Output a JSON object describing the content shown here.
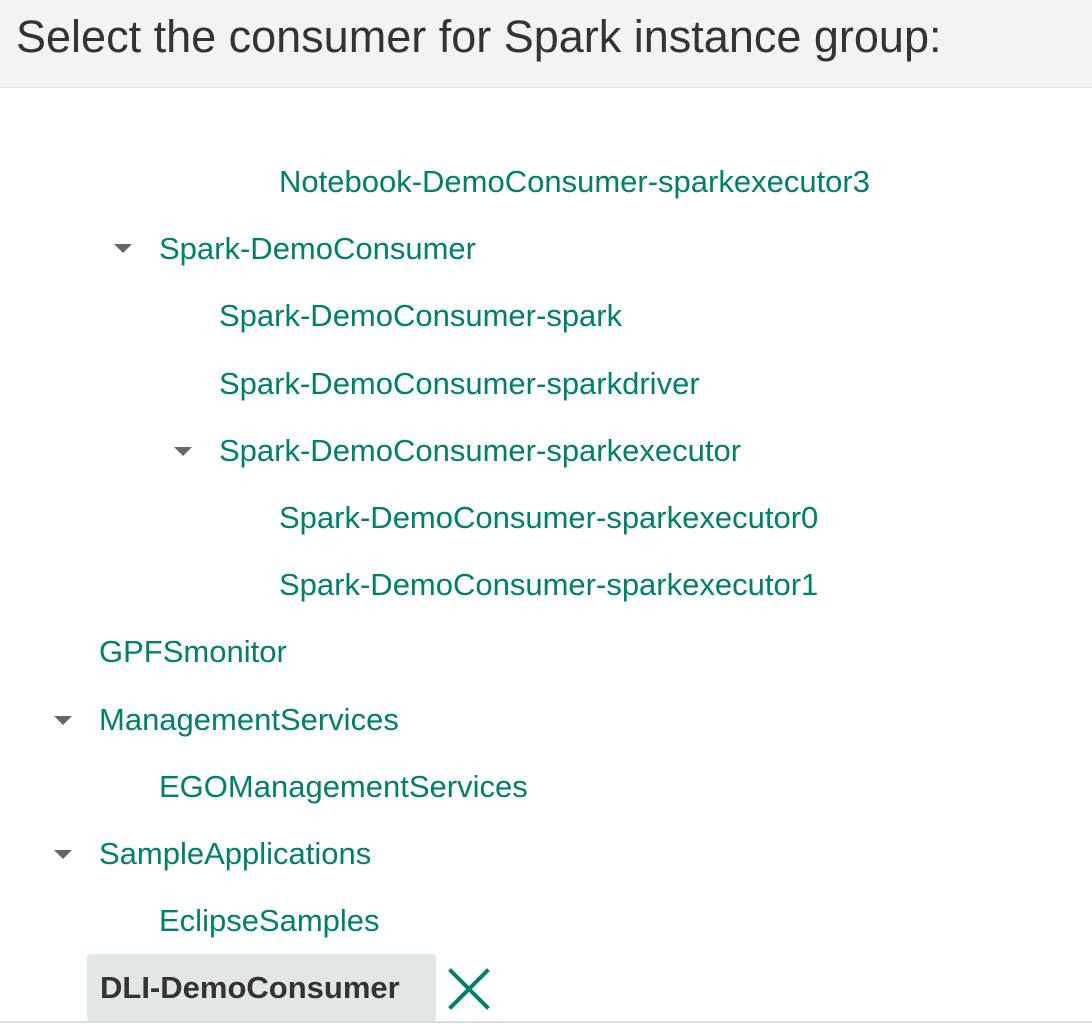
{
  "header": {
    "title": "Select the consumer for Spark instance group:"
  },
  "tree": {
    "nodes": [
      {
        "label": "Notebook-DemoConsumer-sparkexecutor3",
        "expanded": null
      },
      {
        "label": "Spark-DemoConsumer",
        "expanded": true
      },
      {
        "label": "Spark-DemoConsumer-spark",
        "expanded": null
      },
      {
        "label": "Spark-DemoConsumer-sparkdriver",
        "expanded": null
      },
      {
        "label": "Spark-DemoConsumer-sparkexecutor",
        "expanded": true
      },
      {
        "label": "Spark-DemoConsumer-sparkexecutor0",
        "expanded": null
      },
      {
        "label": "Spark-DemoConsumer-sparkexecutor1",
        "expanded": null
      },
      {
        "label": "GPFSmonitor",
        "expanded": null
      },
      {
        "label": "ManagementServices",
        "expanded": true
      },
      {
        "label": "EGOManagementServices",
        "expanded": null
      },
      {
        "label": "SampleApplications",
        "expanded": true
      },
      {
        "label": "EclipseSamples",
        "expanded": null
      }
    ]
  },
  "selection": {
    "label": "DLI-DemoConsumer",
    "remove_icon": "close-icon"
  },
  "colors": {
    "link": "#00806b",
    "header_bg": "#f2f4f4",
    "selected_bg": "#e1e6e6",
    "caret": "#666666"
  }
}
